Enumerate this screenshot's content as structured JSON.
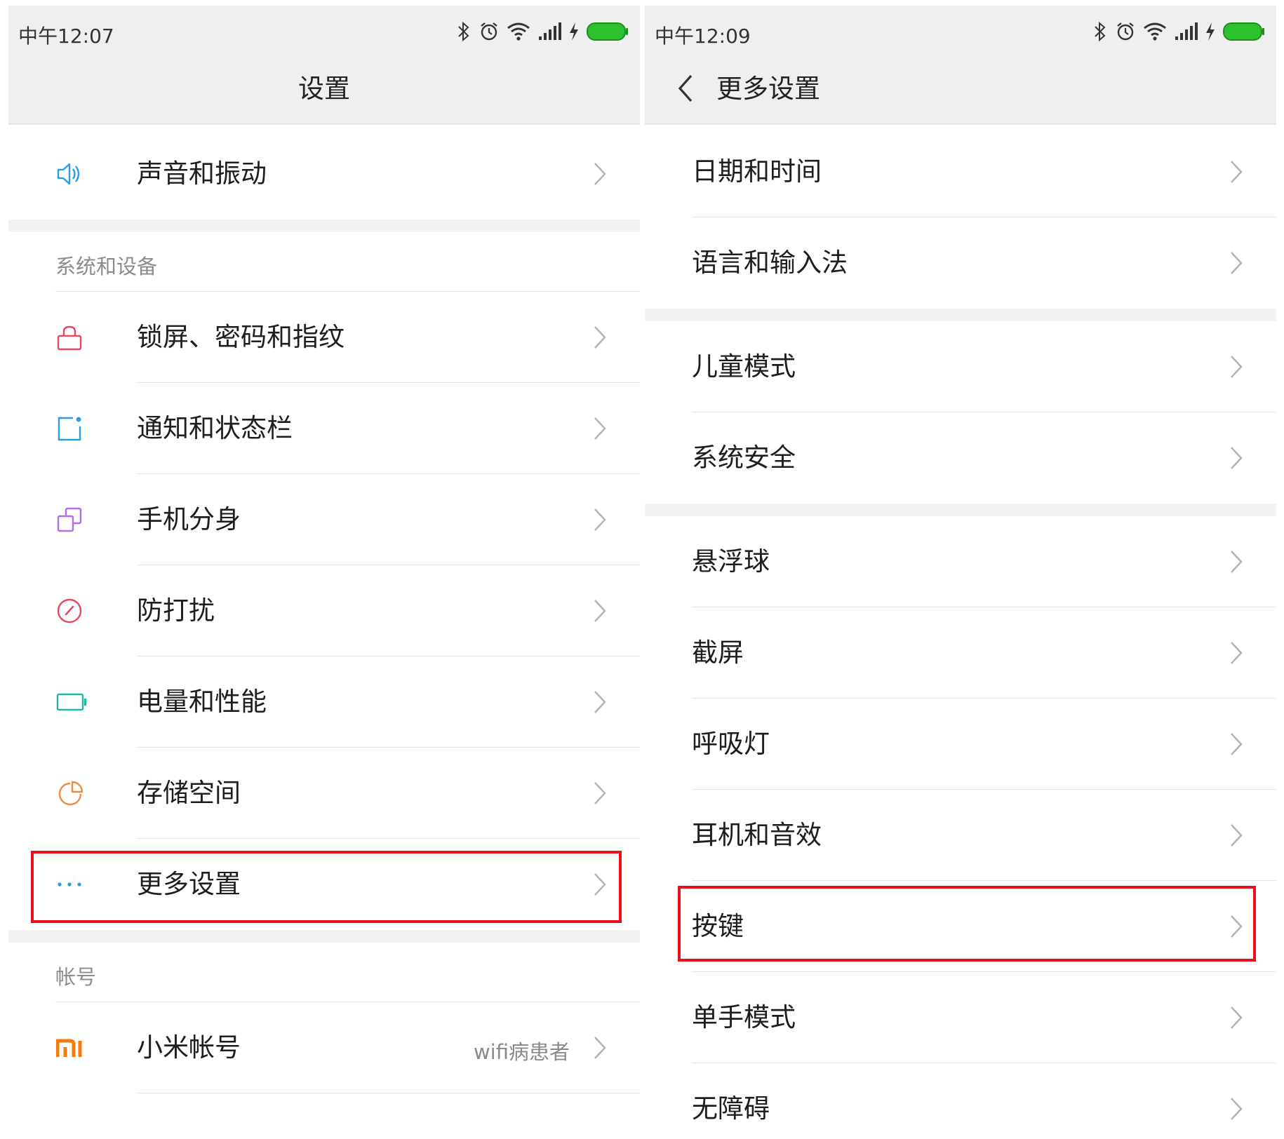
{
  "left": {
    "status": {
      "time": "中午12:07"
    },
    "title": "设置",
    "top_item": {
      "label": "声音和振动",
      "icon": "speaker-icon"
    },
    "section1": "系统和设备",
    "items": [
      {
        "label": "锁屏、密码和指纹",
        "icon": "lock-icon"
      },
      {
        "label": "通知和状态栏",
        "icon": "notification-icon"
      },
      {
        "label": "手机分身",
        "icon": "clone-icon"
      },
      {
        "label": "防打扰",
        "icon": "do-not-disturb-icon"
      },
      {
        "label": "电量和性能",
        "icon": "battery-icon"
      },
      {
        "label": "存储空间",
        "icon": "storage-icon"
      },
      {
        "label": "更多设置",
        "icon": "more-icon",
        "highlighted": true
      }
    ],
    "section2": "帐号",
    "account": {
      "label": "小米帐号",
      "value": "wifi病患者",
      "icon": "mi-logo-icon"
    }
  },
  "right": {
    "status": {
      "time": "中午12:09"
    },
    "title": "更多设置",
    "groups": [
      [
        "日期和时间",
        "语言和输入法"
      ],
      [
        "儿童模式",
        "系统安全"
      ],
      [
        "悬浮球",
        "截屏",
        "呼吸灯",
        "耳机和音效",
        "按键",
        "单手模式",
        "无障碍"
      ]
    ],
    "highlighted_item": "按键"
  },
  "colors": {
    "highlight": "#e8101a",
    "header_bg": "#efefef",
    "divider_bg": "#f2f2f2",
    "battery": "#2ec12e"
  }
}
